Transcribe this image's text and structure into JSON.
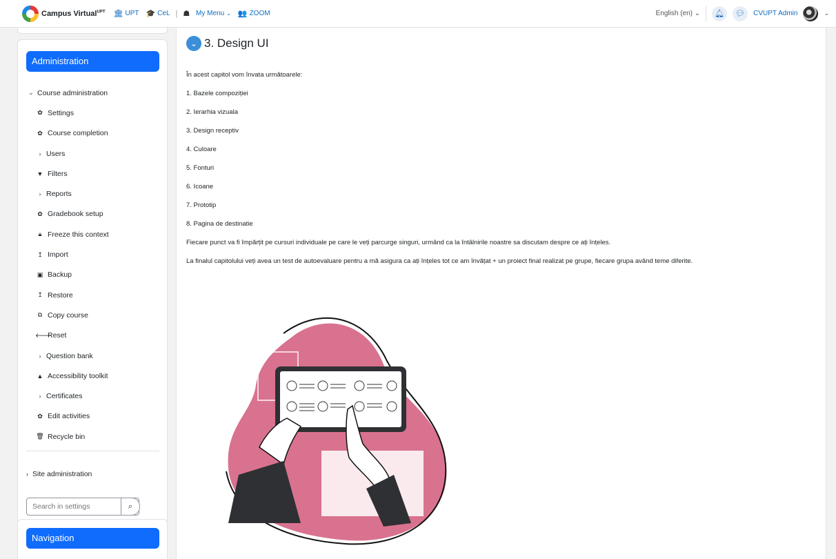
{
  "topnav": {
    "brand": "Campus Virtual",
    "brand_sup": "UPT",
    "links": [
      {
        "label": "UPT",
        "icon": "institution-icon"
      },
      {
        "label": "CeL",
        "icon": "graduation-cap-icon"
      }
    ],
    "divider": "|",
    "my_menu": "My Menu",
    "zoom": "ZOOM",
    "language": "English ‎(en)‎",
    "user": "CVUPT Admin"
  },
  "admin": {
    "title": "Administration",
    "course_admin": "Course administration",
    "items": [
      {
        "label": "Settings",
        "icon": "gear-icon",
        "type": "icon"
      },
      {
        "label": "Course completion",
        "icon": "gear-icon",
        "type": "icon"
      },
      {
        "label": "Users",
        "icon": "chevron-right-icon",
        "type": "chevron"
      },
      {
        "label": "Filters",
        "icon": "filter-icon",
        "type": "icon"
      },
      {
        "label": "Reports",
        "icon": "chevron-right-icon",
        "type": "chevron"
      },
      {
        "label": "Gradebook setup",
        "icon": "gear-icon",
        "type": "icon"
      },
      {
        "label": "Freeze this context",
        "icon": "lock-icon",
        "type": "icon"
      },
      {
        "label": "Import",
        "icon": "upload-icon",
        "type": "icon"
      },
      {
        "label": "Backup",
        "icon": "backup-icon",
        "type": "icon"
      },
      {
        "label": "Restore",
        "icon": "upload-icon",
        "type": "icon"
      },
      {
        "label": "Copy course",
        "icon": "copy-icon",
        "type": "icon"
      },
      {
        "label": "Reset",
        "icon": "arrow-left-icon",
        "type": "icon"
      },
      {
        "label": "Question bank",
        "icon": "chevron-right-icon",
        "type": "chevron"
      },
      {
        "label": "Accessibility toolkit",
        "icon": "chart-icon",
        "type": "icon"
      },
      {
        "label": "Certificates",
        "icon": "chevron-right-icon",
        "type": "chevron"
      },
      {
        "label": "Edit activities",
        "icon": "gear-icon",
        "type": "icon"
      },
      {
        "label": "Recycle bin",
        "icon": "trash-icon",
        "type": "icon"
      }
    ],
    "site_admin": "Site administration",
    "search_placeholder": "Search in settings"
  },
  "navigation": {
    "title": "Navigation"
  },
  "section": {
    "title": "3. Design UI",
    "paragraphs": [
      "În acest capitol vom învata următoarele:",
      "1. Bazele compoziției",
      "2. Ierarhia vizuala",
      "3. Design receptiv",
      "4. Culoare",
      "5. Fonturi",
      "6. Icoane",
      "7. Prototip",
      "8. Pagina de destinatie",
      "Fiecare punct va fi împărțit pe cursuri individuale pe care le veți parcurge singuri, urmând ca la întâlnirile noastre sa discutam despre ce ați înțeles.",
      "La finalul capitolului veți avea un test de autoevaluare pentru a mă asigura ca ați înțeles tot ce am învățat + un proiect final realizat pe grupe, fiecare grupa având teme diferite."
    ]
  },
  "colors": {
    "primary": "#0f6cfd",
    "link": "#0f6cbf",
    "blob": "#d9728f"
  }
}
